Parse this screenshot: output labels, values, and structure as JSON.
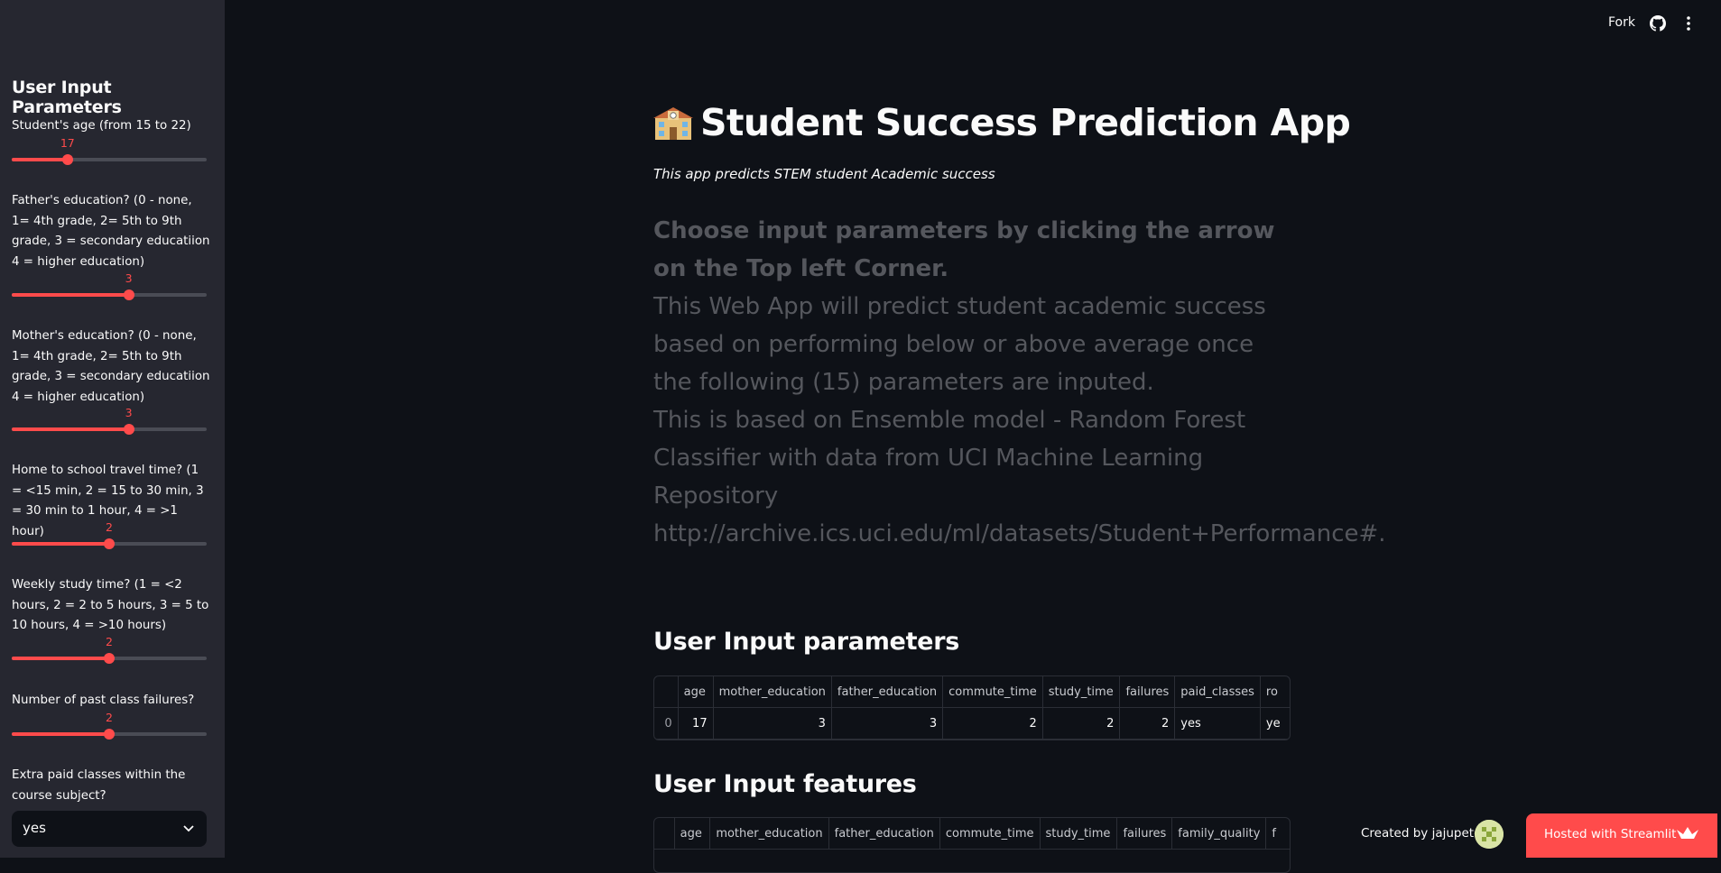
{
  "header": {
    "fork_label": "Fork"
  },
  "sidebar": {
    "title": "User Input Parameters",
    "age": {
      "label": "Student's age (from 15 to 22)",
      "value": "17",
      "fraction": 0.286
    },
    "father_education": {
      "label": "Father's education? (0 - none, 1= 4th grade, 2= 5th to 9th grade, 3 = secondary educatiion 4 = higher education)",
      "value": "3",
      "fraction": 0.6
    },
    "mother_education": {
      "label": "Mother's education? (0 - none, 1= 4th grade, 2= 5th to 9th grade, 3 = secondary educatiion 4 = higher education)",
      "value": "3",
      "fraction": 0.6
    },
    "travel_time": {
      "label": "Home to school travel time? (1 = <15 min, 2 = 15 to 30 min, 3 = 30 min to 1 hour, 4 = >1 hour)",
      "value": "2",
      "fraction": 0.5
    },
    "study_time": {
      "label": "Weekly study time? (1 = <2 hours, 2 = 2 to 5 hours, 3 = 5 to 10 hours, 4 = >10 hours)",
      "value": "2",
      "fraction": 0.5
    },
    "failures": {
      "label": "Number of past class failures?",
      "value": "2",
      "fraction": 0.5
    },
    "paid_classes": {
      "label": "Extra paid classes within the course subject?",
      "value": "yes"
    }
  },
  "main": {
    "title": "Student Success Prediction App",
    "subtitle": "This app predicts STEM student Academic success",
    "desc_bold": "Choose input parameters by clicking the arrow on the Top left Corner.",
    "desc_1": "This Web App will predict student academic success based on performing below or above average once the following (15) parameters are inputed.",
    "desc_2": "This is based on Ensemble model - Random Forest Classifier with data from UCI Machine Learning Repository http://archive.ics.uci.edu/ml/datasets/Student+Performance#.",
    "params_heading": "User Input parameters",
    "params_table": {
      "headers": [
        "",
        "age",
        "mother_education",
        "father_education",
        "commute_time",
        "study_time",
        "failures",
        "paid_classes",
        "ro"
      ],
      "row": [
        "0",
        "17",
        "3",
        "3",
        "2",
        "2",
        "2",
        "yes",
        "ye"
      ]
    },
    "features_heading": "User Input features",
    "features_table": {
      "headers": [
        "",
        "age",
        "mother_education",
        "father_education",
        "commute_time",
        "study_time",
        "failures",
        "family_quality",
        "f"
      ]
    }
  },
  "footer": {
    "created_by": "Created by jajupeter",
    "hosted": "Hosted with Streamlit"
  },
  "colors": {
    "accent": "#ff4b4b",
    "background": "#0e1117",
    "sidebar": "#262730"
  }
}
